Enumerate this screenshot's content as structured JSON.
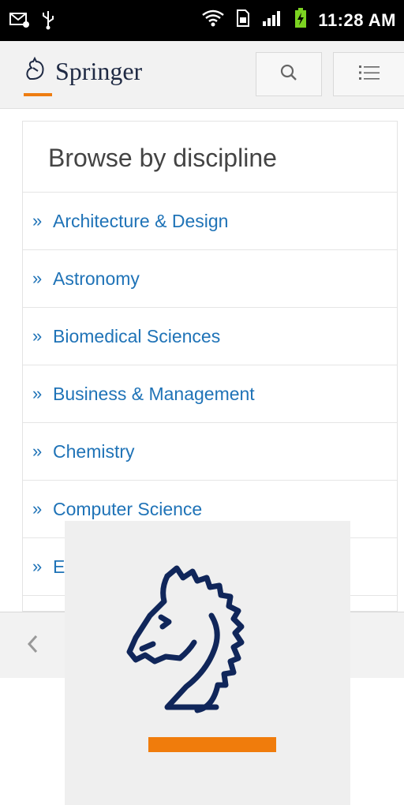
{
  "status_bar": {
    "time": "11:28 AM",
    "icons": [
      "email-icon",
      "usb-icon",
      "wifi-icon",
      "sim-icon",
      "signal-icon",
      "battery-charging-icon"
    ]
  },
  "header": {
    "logo_text": "Springer",
    "search_icon": "search-icon",
    "menu_icon": "menu-list-icon",
    "accent_color": "#ee7d11"
  },
  "browse": {
    "title": "Browse by discipline",
    "bullet": "»",
    "items": [
      "Architecture & Design",
      "Astronomy",
      "Biomedical Sciences",
      "Business & Management",
      "Chemistry",
      "Computer Science",
      "E"
    ]
  },
  "bottom_bar": {
    "back_icon": "chevron-left-icon"
  },
  "splash": {
    "logo_icon": "springer-horse-logo",
    "bar_color": "#f07c0c",
    "logo_color": "#10265a"
  }
}
